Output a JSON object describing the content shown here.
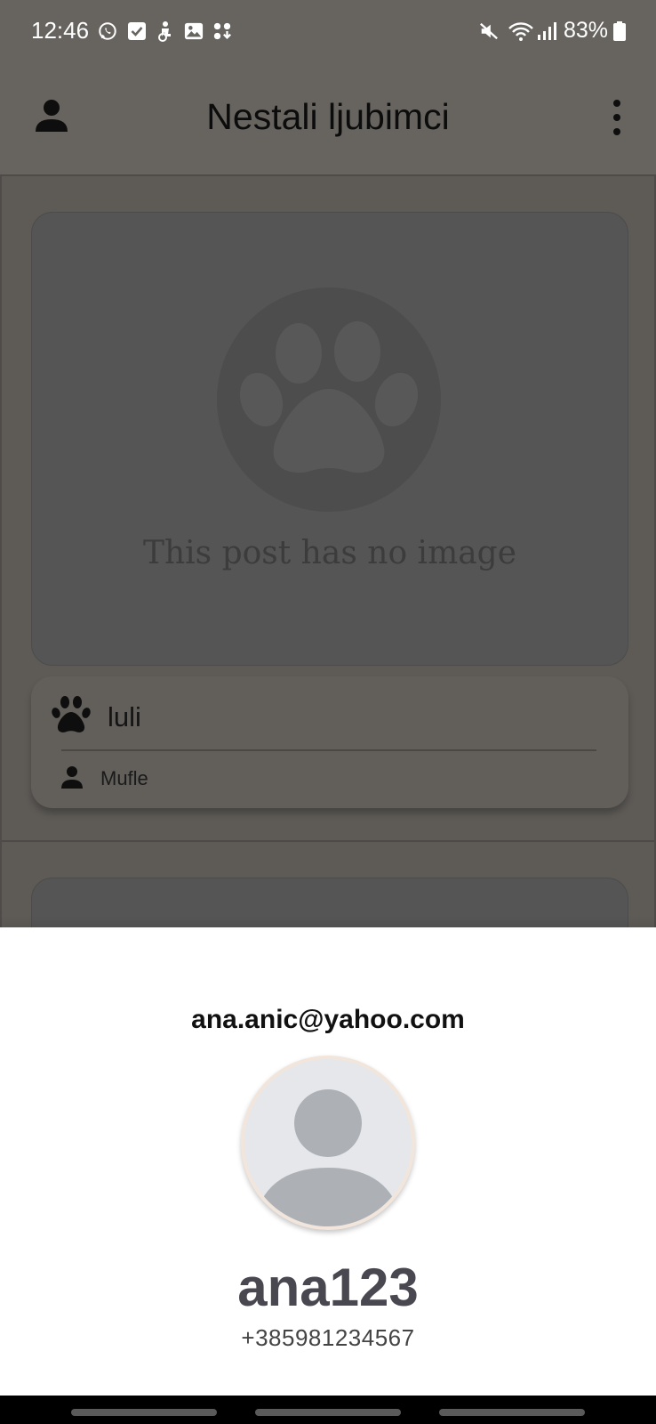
{
  "status_bar": {
    "time": "12:46",
    "battery": "83%",
    "notification_icons": [
      "whatsapp-icon",
      "checkbox-icon",
      "accessibility-icon",
      "gallery-icon",
      "download-icon"
    ],
    "system_icons": [
      "mute-icon",
      "wifi-icon",
      "signal-icon",
      "battery-icon"
    ]
  },
  "app_bar": {
    "title": "Nestali ljubimci"
  },
  "post": {
    "no_image_text": "This post has no image",
    "pet_name": "luli",
    "owner": "Mufle"
  },
  "profile_sheet": {
    "email": "ana.anic@yahoo.com",
    "username": "ana123",
    "phone": "+385981234567"
  },
  "colors": {
    "dim_background": "#5e5b57",
    "username_color": "#494850",
    "avatar_bg": "#e5e7ea",
    "avatar_silhouette": "#adb1b6"
  }
}
